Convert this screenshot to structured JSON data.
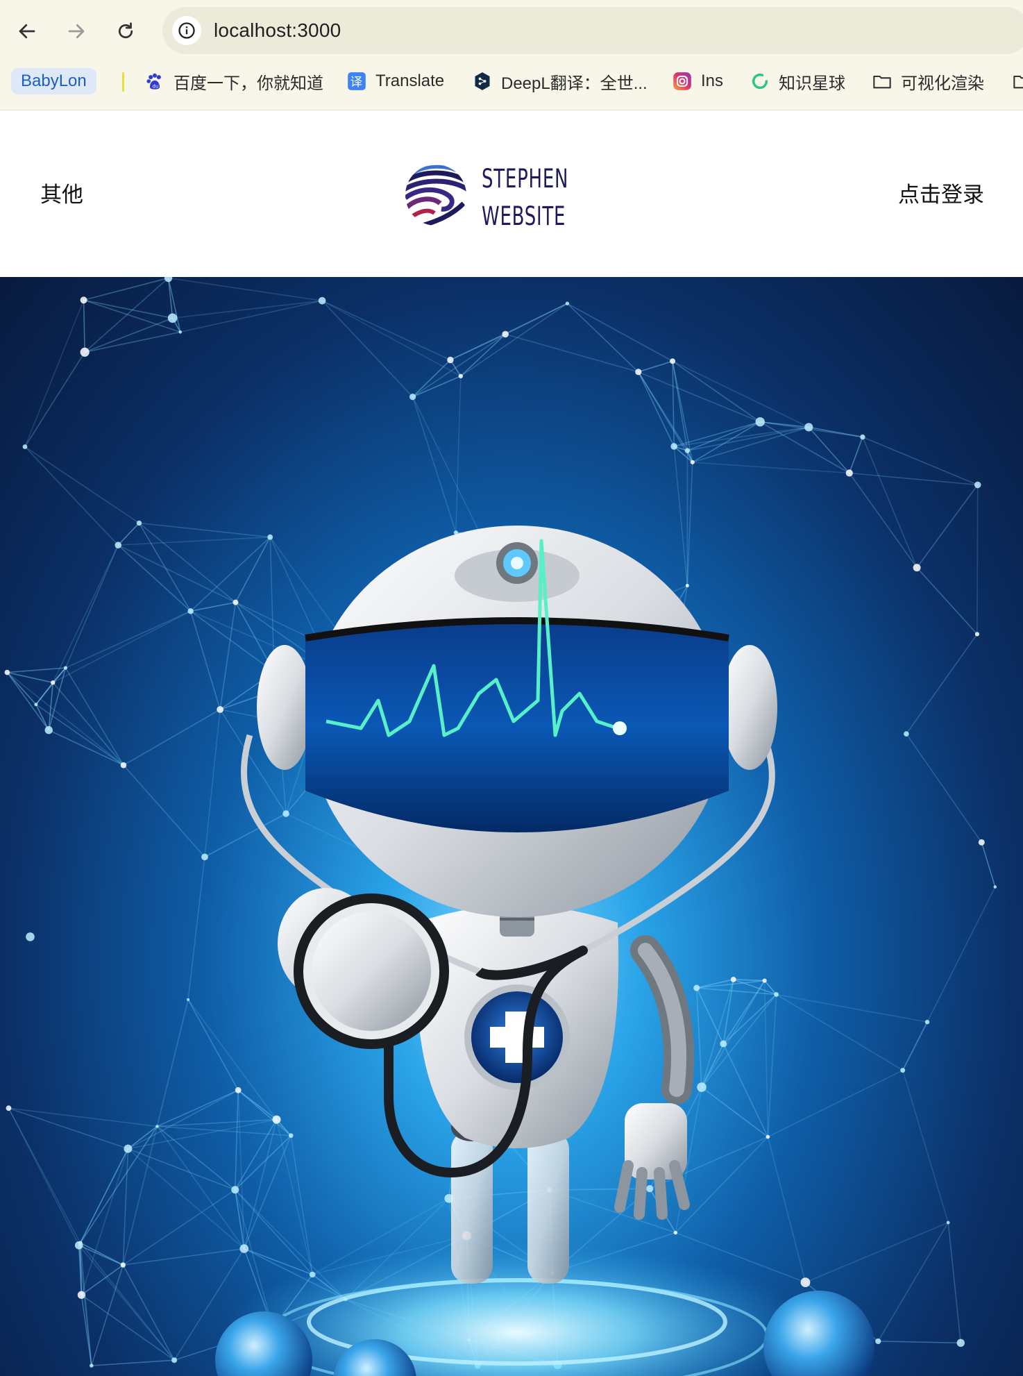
{
  "browser": {
    "url": "localhost:3000",
    "bookmarks": [
      {
        "label": "BabyLon",
        "icon": "babylon-chip"
      },
      {
        "label": "百度一下，你就知道",
        "icon": "baidu-paw-icon"
      },
      {
        "label": "Translate",
        "icon": "translate-icon"
      },
      {
        "label": "DeepL翻译：全世...",
        "icon": "deepl-icon"
      },
      {
        "label": "Ins",
        "icon": "instagram-icon"
      },
      {
        "label": "知识星球",
        "icon": "zsxq-icon"
      },
      {
        "label": "可视化渲染",
        "icon": "folder-icon"
      }
    ]
  },
  "header": {
    "left_link": "其他",
    "right_link": "点击登录",
    "logo_line1": "STEPHEN",
    "logo_line2": "WEBSITE"
  },
  "hero": {
    "image": "medical robot with stethoscope on blue network background"
  },
  "colors": {
    "chrome_bg": "#f7f6e9",
    "omnibox_bg": "#ecebd9",
    "logo_text": "#1e1b5c",
    "chip_text": "#1b5fc4"
  }
}
